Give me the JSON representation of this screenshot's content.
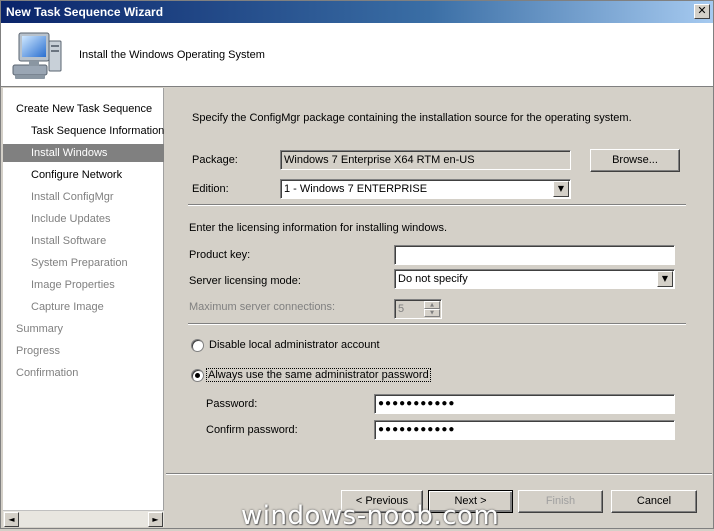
{
  "window": {
    "title": "New Task Sequence Wizard",
    "close_glyph": "✕"
  },
  "header": {
    "title": "Install the Windows Operating System",
    "icon": "computer-icon"
  },
  "sidebar": {
    "items": [
      {
        "label": "Create New Task Sequence",
        "state": "normal"
      },
      {
        "label": "Task Sequence Information",
        "state": "normal"
      },
      {
        "label": "Install Windows",
        "state": "selected"
      },
      {
        "label": "Configure Network",
        "state": "normal"
      },
      {
        "label": "Install ConfigMgr",
        "state": "disabled"
      },
      {
        "label": "Include Updates",
        "state": "disabled"
      },
      {
        "label": "Install Software",
        "state": "disabled"
      },
      {
        "label": "System Preparation",
        "state": "disabled"
      },
      {
        "label": "Image Properties",
        "state": "disabled"
      },
      {
        "label": "Capture Image",
        "state": "disabled"
      },
      {
        "label": "Summary",
        "state": "disabled"
      },
      {
        "label": "Progress",
        "state": "disabled"
      },
      {
        "label": "Confirmation",
        "state": "disabled"
      }
    ],
    "scroll_left": "◄",
    "scroll_right": "►"
  },
  "main": {
    "intro": "Specify the ConfigMgr package containing the installation source for the operating system.",
    "package_label": "Package:",
    "package_value": "Windows 7 Enterprise X64 RTM en-US",
    "browse_label": "Browse...",
    "edition_label": "Edition:",
    "edition_value": "1 - Windows 7 ENTERPRISE",
    "licensing_intro": "Enter the licensing information for installing windows.",
    "product_key_label": "Product key:",
    "product_key_value": "",
    "server_mode_label": "Server licensing mode:",
    "server_mode_value": "Do not specify",
    "max_conn_label": "Maximum server connections:",
    "max_conn_value": "5",
    "disable_admin_label": "Disable local administrator account",
    "disable_admin_checked": false,
    "same_password_label": "Always use the same administrator password",
    "same_password_checked": true,
    "password_label": "Password:",
    "password_value": "●●●●●●●●●●●",
    "confirm_label": "Confirm password:",
    "confirm_value": "●●●●●●●●●●●",
    "dropdown_glyph": "▼",
    "spin_up": "▲",
    "spin_down": "▼"
  },
  "buttons": {
    "previous": "< Previous",
    "next": "Next >",
    "finish": "Finish",
    "cancel": "Cancel"
  },
  "watermark": "windows-noob.com"
}
